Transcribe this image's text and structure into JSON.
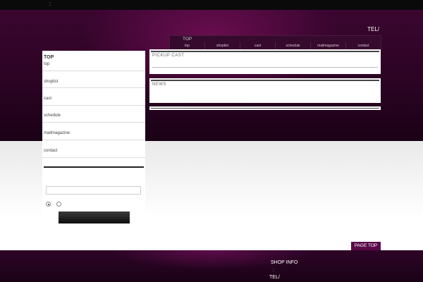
{
  "topbar": {
    "mark": ":"
  },
  "header": {
    "tel": "TEL/",
    "nav_label": "TOP",
    "nav_items": [
      "top",
      "shoplist",
      "cast",
      "schedule",
      "mailmagazine",
      "contact"
    ]
  },
  "sidebar": {
    "title": "TOP",
    "items": [
      "top",
      "shoplist",
      "cast",
      "schedule",
      "mailmagazine",
      "contact"
    ]
  },
  "panels": {
    "pickup": "PICKUP CAST",
    "news": "NEWS"
  },
  "pagetop": "PAGE TOP",
  "footer": {
    "title": "SHOP INFO",
    "colon": ":",
    "tel": "TEL/"
  }
}
